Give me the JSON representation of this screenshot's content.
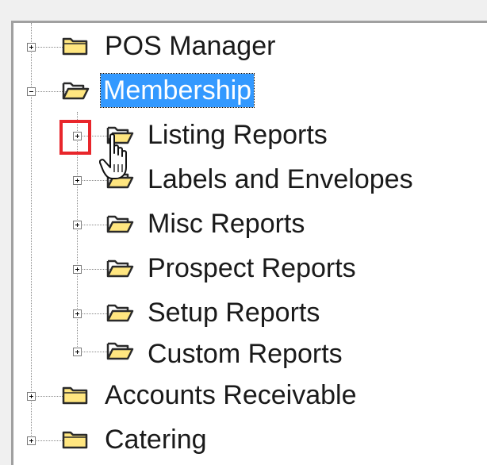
{
  "tree": {
    "nodes": [
      {
        "label": "POS Manager",
        "level": 0,
        "expanded": false,
        "icon": "folder-closed-icon"
      },
      {
        "label": "Membership",
        "level": 0,
        "expanded": true,
        "selected": true,
        "icon": "folder-open-icon"
      },
      {
        "label": "Listing Reports",
        "level": 1,
        "expanded": false,
        "icon": "folder-open-icon"
      },
      {
        "label": "Labels and Envelopes",
        "level": 1,
        "expanded": false,
        "icon": "folder-open-icon"
      },
      {
        "label": "Misc Reports",
        "level": 1,
        "expanded": false,
        "icon": "folder-open-icon"
      },
      {
        "label": "Prospect Reports",
        "level": 1,
        "expanded": false,
        "icon": "folder-open-icon"
      },
      {
        "label": "Setup Reports",
        "level": 1,
        "expanded": false,
        "icon": "folder-open-icon"
      },
      {
        "label": "Custom Reports",
        "level": 1,
        "expanded": false,
        "icon": "folder-open-icon"
      },
      {
        "label": "Accounts Receivable",
        "level": 0,
        "expanded": false,
        "icon": "folder-closed-icon"
      },
      {
        "label": "Catering",
        "level": 0,
        "expanded": false,
        "icon": "folder-closed-icon"
      }
    ]
  },
  "colors": {
    "selection": "#3399ff",
    "highlight": "#e8262b",
    "folder_fill": "#ffe680",
    "folder_stroke": "#2a2a2a"
  },
  "cursor": {
    "icon": "hand-pointer-icon"
  }
}
